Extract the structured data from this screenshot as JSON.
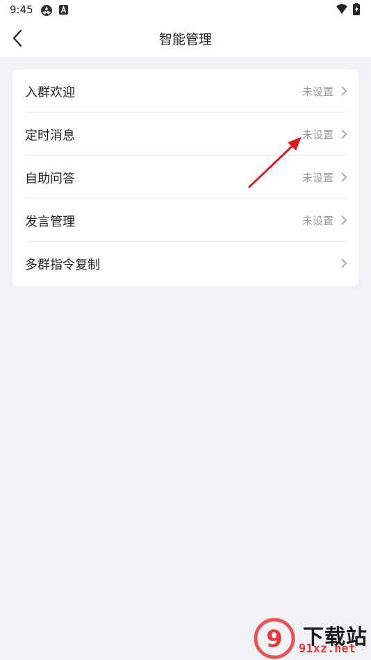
{
  "status_bar": {
    "time": "9:45",
    "icons": [
      "settings-app-icon",
      "a-notification-icon",
      "wifi-icon",
      "battery-icon"
    ]
  },
  "nav": {
    "title": "智能管理",
    "back_icon": "chevron-left-icon"
  },
  "settings_list": {
    "items": [
      {
        "label": "入群欢迎",
        "value": "未设置"
      },
      {
        "label": "定时消息",
        "value": "未设置"
      },
      {
        "label": "自助问答",
        "value": "未设置"
      },
      {
        "label": "发言管理",
        "value": "未设置"
      },
      {
        "label": "多群指令复制",
        "value": ""
      }
    ]
  },
  "annotation": {
    "icon": "red-arrow-icon",
    "color": "#d81e1e"
  },
  "watermark": {
    "title": "下载站",
    "url": "91xz.net",
    "logo_text": "9",
    "color": "#e23b3b"
  }
}
